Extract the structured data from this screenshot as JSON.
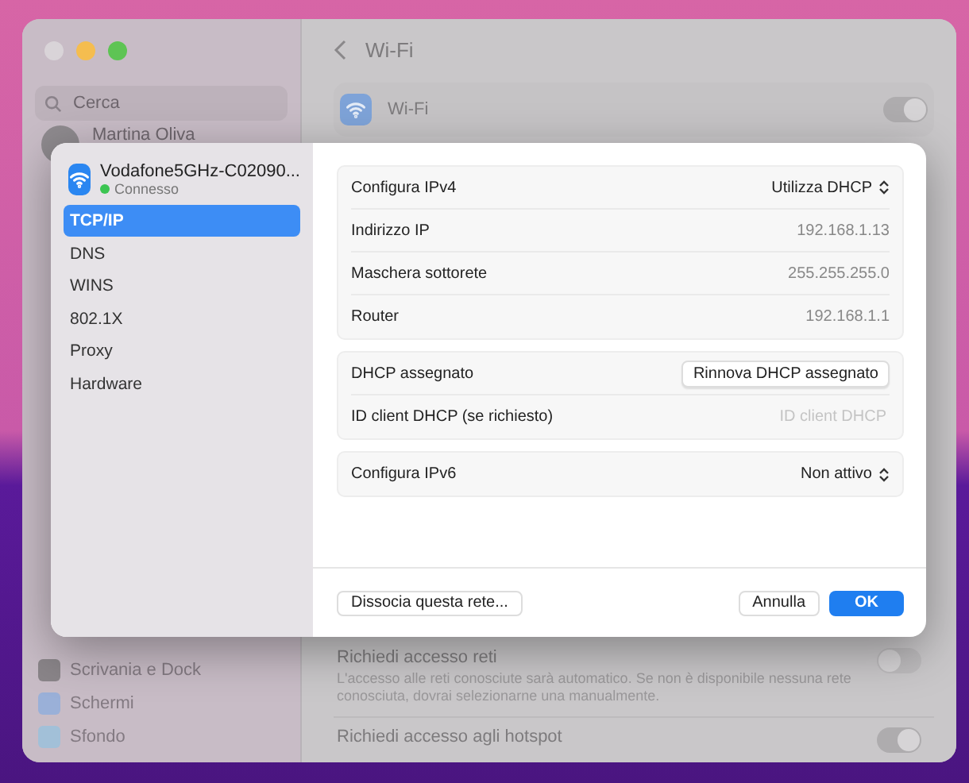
{
  "window": {
    "traffic_lights": [
      {
        "color": "#d9d4d8"
      },
      {
        "color": "#f5bd4f"
      },
      {
        "color": "#5ec454"
      }
    ]
  },
  "sidebar": {
    "search": {
      "placeholder": "Cerca"
    },
    "user": {
      "name": "Martina Oliva"
    },
    "items": [
      {
        "label": "Scrivania e Dock",
        "color": "#8a8589"
      },
      {
        "label": "Schermi",
        "color": "#9ab0d8"
      },
      {
        "label": "Sfondo",
        "color": "#a2c0d8"
      }
    ]
  },
  "header": {
    "title": "Wi-Fi"
  },
  "wifi_row": {
    "label": "Wi-Fi",
    "on": true
  },
  "settings": [
    {
      "label": "Richiedi accesso reti",
      "description": "L'accesso alle reti conosciute sarà automatico. Se non è disponibile nessuna rete conosciuta, dovrai selezionarne una manualmente.",
      "on": false
    },
    {
      "label": "Richiedi accesso agli hotspot",
      "on": true
    }
  ],
  "sheet": {
    "network": {
      "name": "Vodafone5GHz-C02090...",
      "status": "Connesso"
    },
    "tabs": [
      {
        "label": "TCP/IP",
        "selected": true
      },
      {
        "label": "DNS",
        "selected": false
      },
      {
        "label": "WINS",
        "selected": false
      },
      {
        "label": "802.1X",
        "selected": false
      },
      {
        "label": "Proxy",
        "selected": false
      },
      {
        "label": "Hardware",
        "selected": false
      }
    ],
    "groups": [
      [
        {
          "kind": "popup",
          "label": "Configura IPv4",
          "value": "Utilizza DHCP"
        },
        {
          "kind": "value",
          "label": "Indirizzo IP",
          "value": "192.168.1.13"
        },
        {
          "kind": "value",
          "label": "Maschera sottorete",
          "value": "255.255.255.0"
        },
        {
          "kind": "value",
          "label": "Router",
          "value": "192.168.1.1"
        }
      ],
      [
        {
          "kind": "button",
          "label": "DHCP assegnato",
          "value": "Rinnova DHCP assegnato"
        },
        {
          "kind": "field",
          "label": "ID client DHCP (se richiesto)",
          "placeholder": "ID client DHCP"
        }
      ],
      [
        {
          "kind": "popup",
          "label": "Configura IPv6",
          "value": "Non attivo"
        }
      ]
    ],
    "buttons": {
      "left": "Dissocia questa rete...",
      "cancel": "Annulla",
      "ok": "OK"
    }
  }
}
